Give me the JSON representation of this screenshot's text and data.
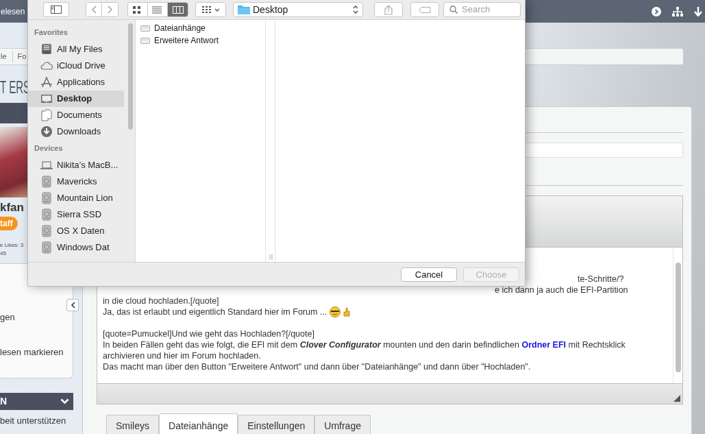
{
  "forum": {
    "topbar_text": "elesen",
    "breadcrumbs": [
      "le",
      "Fo"
    ],
    "title": "T ERS",
    "user": {
      "name": "kfan",
      "badge": "taff",
      "stats": [
        "e Likes: 3",
        "45"
      ]
    },
    "sidebar_links": [
      "gen",
      "lesen markieren"
    ],
    "panel_header": "N",
    "panel_text": "beit unterstützen",
    "editor_lines": [
      {
        "kind": "cut",
        "text": "te-Schritte/?"
      },
      {
        "kind": "cut",
        "text": "e ich dann ja auch die EFI-Partition"
      },
      {
        "kind": "plain",
        "text": "in die cloud hochladen.[/quote]"
      },
      {
        "kind": "emoticons",
        "text": "Ja, das ist erlaubt und eigentlich Standard hier im Forum ..."
      },
      {
        "kind": "blank"
      },
      {
        "kind": "plain",
        "text": "[quote=Pumuckel]Und wie geht das Hochladen?[/quote]"
      },
      {
        "kind": "segments",
        "segments": [
          {
            "kind": "plain",
            "text": "In beiden Fällen geht das wie folgt, die EFI mit dem "
          },
          {
            "kind": "bolditalic",
            "text": "Clover Configurator"
          },
          {
            "kind": "plain",
            "text": " mounten und den darin befindlichen "
          },
          {
            "kind": "link",
            "text": "Ordner EFI"
          },
          {
            "kind": "plain",
            "text": " mit Rechtsklick"
          }
        ]
      },
      {
        "kind": "plain",
        "text": "archivieren und hier im Forum hochladen."
      },
      {
        "kind": "plain",
        "text": "Das macht man über den Button \"Erweitere Antwort\" und dann über \"Dateianhänge\" und dann über \"Hochladen\"."
      }
    ],
    "tabs": [
      {
        "label": "Smileys",
        "selected": false
      },
      {
        "label": "Dateianhänge",
        "selected": true
      },
      {
        "label": "Einstellungen",
        "selected": false
      },
      {
        "label": "Umfrage",
        "selected": false
      }
    ]
  },
  "dialog": {
    "views": [
      {
        "kind": "icons",
        "selected": false
      },
      {
        "kind": "list",
        "selected": false
      },
      {
        "kind": "columns",
        "selected": true
      }
    ],
    "path": "Desktop",
    "search_placeholder": "Search",
    "sidebar": [
      {
        "title": "Favorites",
        "items": [
          {
            "kind": "allfiles",
            "label": "All My Files",
            "selected": false
          },
          {
            "kind": "cloud",
            "label": "iCloud Drive",
            "selected": false
          },
          {
            "kind": "apps",
            "label": "Applications",
            "selected": false
          },
          {
            "kind": "desktop",
            "label": "Desktop",
            "selected": true
          },
          {
            "kind": "documents",
            "label": "Documents",
            "selected": false
          },
          {
            "kind": "downloads",
            "label": "Downloads",
            "selected": false
          }
        ]
      },
      {
        "title": "Devices",
        "items": [
          {
            "kind": "laptop",
            "label": "Nikita’s MacB...",
            "selected": false
          },
          {
            "kind": "disk",
            "label": "Mavericks",
            "selected": false
          },
          {
            "kind": "disk",
            "label": "Mountain Lion",
            "selected": false
          },
          {
            "kind": "disk",
            "label": "Sierra SSD",
            "selected": false
          },
          {
            "kind": "disk",
            "label": "OS X Daten",
            "selected": false
          },
          {
            "kind": "disk",
            "label": "Windows Dat",
            "selected": false
          }
        ]
      }
    ],
    "files": [
      "Dateianhänge",
      "Erweitere Antwort"
    ],
    "buttons": [
      {
        "label": "Cancel",
        "disabled": false
      },
      {
        "label": "Choose",
        "disabled": true
      }
    ]
  }
}
